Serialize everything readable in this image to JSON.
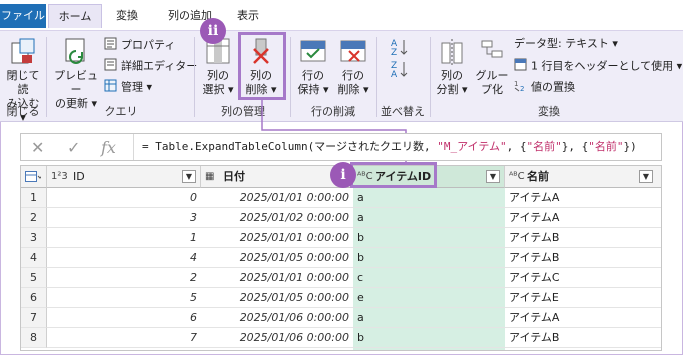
{
  "menu": {
    "tabs": [
      "ファイル",
      "ホーム",
      "変換",
      "列の追加",
      "表示"
    ]
  },
  "ribbon": {
    "close": {
      "label1": "閉じて読",
      "label2": "み込む ▾",
      "group": "閉じる"
    },
    "preview": {
      "label1": "プレビュー",
      "label2": "の更新 ▾"
    },
    "query_items": [
      "プロパティ",
      "詳細エディター",
      "管理 ▾"
    ],
    "query_group": "クエリ",
    "select_cols": {
      "label1": "列の",
      "label2": "選択 ▾"
    },
    "remove_cols": {
      "label1": "列の",
      "label2": "削除 ▾"
    },
    "col_group": "列の管理",
    "keep_rows": {
      "label1": "行の",
      "label2": "保持 ▾"
    },
    "remove_rows": {
      "label1": "行の",
      "label2": "削除 ▾"
    },
    "row_group": "行の削減",
    "sort_group": "並べ替え",
    "split": {
      "label1": "列の",
      "label2": "分割 ▾"
    },
    "group_by": {
      "label1": "グルー",
      "label2": "プ化"
    },
    "transform_items": [
      "データ型: テキスト ▾",
      "1 行目をヘッダーとして使用 ▾",
      "値の置換"
    ],
    "transform_group": "変換"
  },
  "formula": {
    "prefix": "= Table.ExpandTableColumn(マージされたクエリ数, ",
    "arg1": "\"M_アイテム\"",
    "mid": ", {",
    "arg2": "\"名前\"",
    "mid2": "}, {",
    "arg3": "\"名前\"",
    "suffix": "})"
  },
  "grid": {
    "headers": {
      "id": "ID",
      "date": "日付",
      "item": "アイテムID",
      "name": "名前"
    },
    "type_badges": {
      "id": "1²3",
      "date": "▦",
      "item": "ᴬᴮC",
      "name": "ᴬᴮC"
    },
    "rows": [
      {
        "n": "1",
        "id": "0",
        "date": "2025/01/01 0:00:00",
        "item": "a",
        "name": "アイテムA"
      },
      {
        "n": "2",
        "id": "3",
        "date": "2025/01/02 0:00:00",
        "item": "a",
        "name": "アイテムA"
      },
      {
        "n": "3",
        "id": "1",
        "date": "2025/01/01 0:00:00",
        "item": "b",
        "name": "アイテムB"
      },
      {
        "n": "4",
        "id": "4",
        "date": "2025/01/05 0:00:00",
        "item": "b",
        "name": "アイテムB"
      },
      {
        "n": "5",
        "id": "2",
        "date": "2025/01/01 0:00:00",
        "item": "c",
        "name": "アイテムC"
      },
      {
        "n": "6",
        "id": "5",
        "date": "2025/01/05 0:00:00",
        "item": "e",
        "name": "アイテムE"
      },
      {
        "n": "7",
        "id": "6",
        "date": "2025/01/06 0:00:00",
        "item": "a",
        "name": "アイテムA"
      },
      {
        "n": "8",
        "id": "7",
        "date": "2025/01/06 0:00:00",
        "item": "b",
        "name": "アイテムB"
      }
    ]
  },
  "callouts": {
    "i": "i",
    "ii": "ii"
  },
  "colors": {
    "accent": "#9b59b6",
    "file_tab": "#1f6fb6",
    "selected_col": "#d6efe3"
  }
}
